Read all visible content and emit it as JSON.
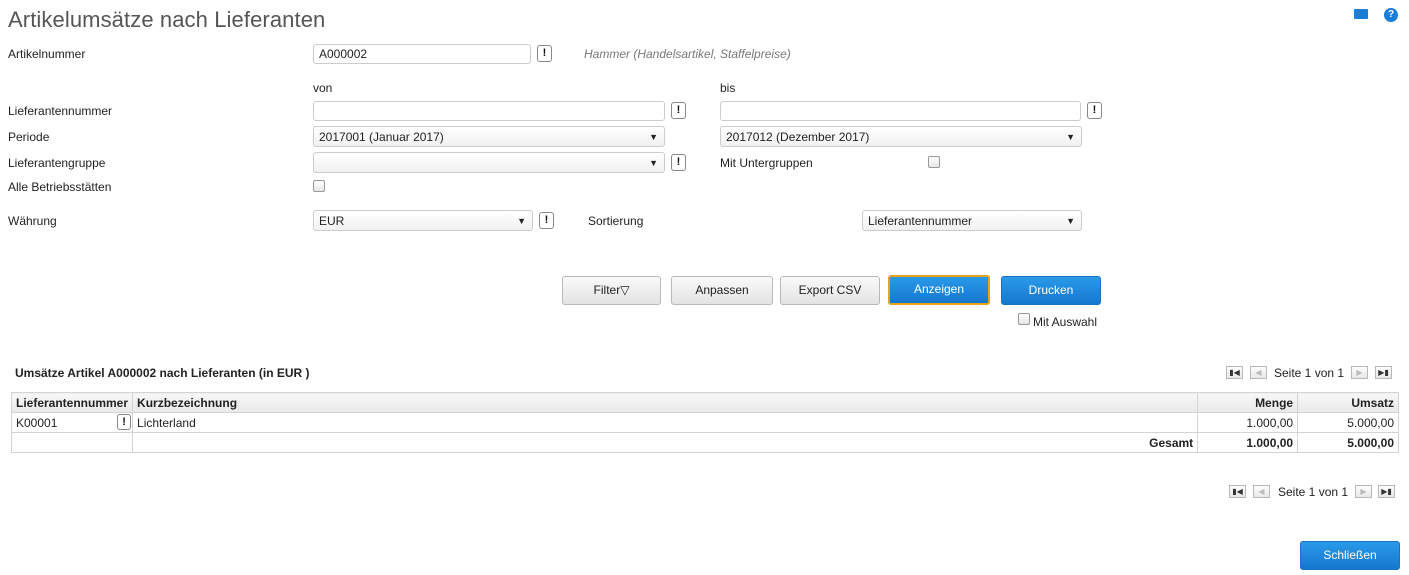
{
  "page": {
    "title": "Artikelumsätze nach Lieferanten"
  },
  "form": {
    "artikelnummer_label": "Artikelnummer",
    "artikelnummer_value": "A000002",
    "artikel_hint": "Hammer (Handelsartikel, Staffelpreise)",
    "von_label": "von",
    "bis_label": "bis",
    "lieferantennummer_label": "Lieferantennummer",
    "lieferantennummer_von": "",
    "lieferantennummer_bis": "",
    "periode_label": "Periode",
    "periode_von": "2017001 (Januar 2017)",
    "periode_bis": "2017012 (Dezember 2017)",
    "lieferantengruppe_label": "Lieferantengruppe",
    "lieferantengruppe_value": "",
    "mit_untergruppen_label": "Mit Untergruppen",
    "alle_betriebsstaetten_label": "Alle Betriebsstätten",
    "waehrung_label": "Währung",
    "waehrung_value": "EUR",
    "sortierung_label": "Sortierung",
    "sortierung_value": "Lieferantennummer",
    "excl_symbol": "!",
    "dropdown_arrow": "▼"
  },
  "actions": {
    "filter_label": "Filter▽",
    "anpassen_label": "Anpassen",
    "export_csv_label": "Export CSV",
    "anzeigen_label": "Anzeigen",
    "drucken_label": "Drucken",
    "mit_auswahl_label": "Mit Auswahl",
    "schliessen_label": "Schließen"
  },
  "result": {
    "title": "Umsätze Artikel A000002 nach Lieferanten (in EUR )",
    "pager_text": "Seite 1 von 1",
    "columns": [
      "Lieferantennummer",
      "Kurzbezeichnung",
      "Menge",
      "Umsatz"
    ],
    "rows": [
      {
        "lieferantennummer": "K00001",
        "kurzbezeichnung": "Lichterland",
        "menge": "1.000,00",
        "umsatz": "5.000,00"
      }
    ],
    "total": {
      "label": "Gesamt",
      "menge": "1.000,00",
      "umsatz": "5.000,00"
    }
  },
  "pager_icons": {
    "first": "▮◀",
    "prev": "◀",
    "next": "▶",
    "last": "▶▮"
  },
  "header_icons": {
    "mail": "mail-icon",
    "help": "help-icon",
    "help_glyph": "?"
  }
}
